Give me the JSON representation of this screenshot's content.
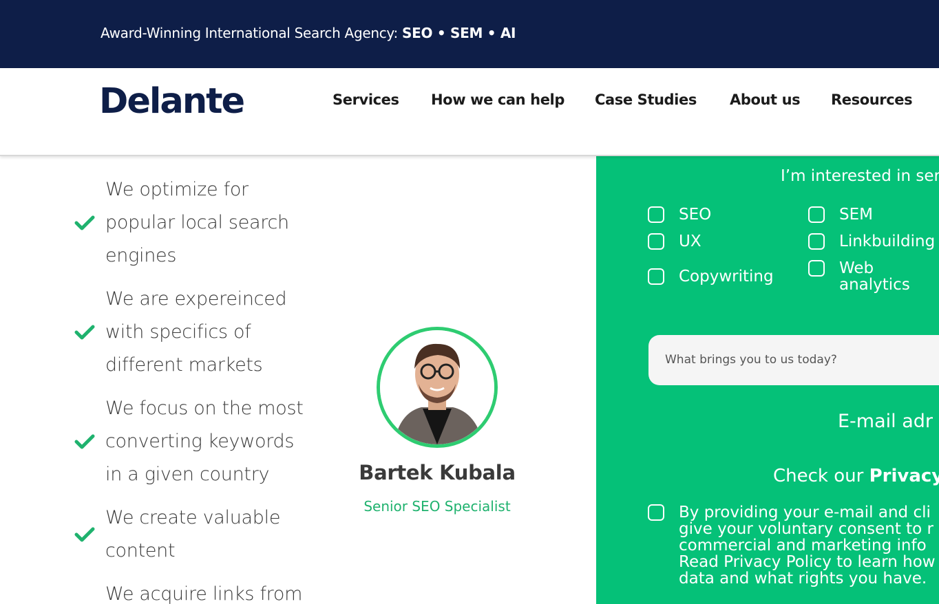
{
  "topbar": {
    "tagline_prefix": "Award-Winning International Search Agency: ",
    "tagline_bold": "SEO • SEM • AI"
  },
  "header": {
    "logo": "Delante",
    "nav": [
      "Services",
      "How we can help",
      "Case Studies",
      "About us",
      "Resources"
    ]
  },
  "features": [
    "We optimize for\npopular local search\nengines",
    "We are expereinced\nwith specifics of\ndifferent markets",
    "We focus on the most\nconverting keywords\nin a given country",
    "We create valuable\ncontent",
    "We acquire links from"
  ],
  "specialist": {
    "name": "Bartek Kubala",
    "role": "Senior SEO Specialist"
  },
  "form": {
    "heading": "I’m interested in ser",
    "services": [
      "SEO",
      "SEM",
      "UX",
      "Linkbuilding",
      "Copywriting",
      "Web\nanalytics"
    ],
    "textarea_placeholder": "What brings you to us today?",
    "email_label": "E-mail adr",
    "privacy_prefix": "Check our ",
    "privacy_link": "Privacy",
    "consent": "By providing your e-mail and cli\ngive your voluntary consent to r\ncommercial and marketing info\nRead Privacy Policy to learn how\ndata and what rights you have."
  },
  "colors": {
    "topbar_bg": "#0e1e48",
    "accent_green": "#05c178",
    "check_green": "#1fb26e"
  },
  "icons": {
    "check": "check-icon"
  }
}
